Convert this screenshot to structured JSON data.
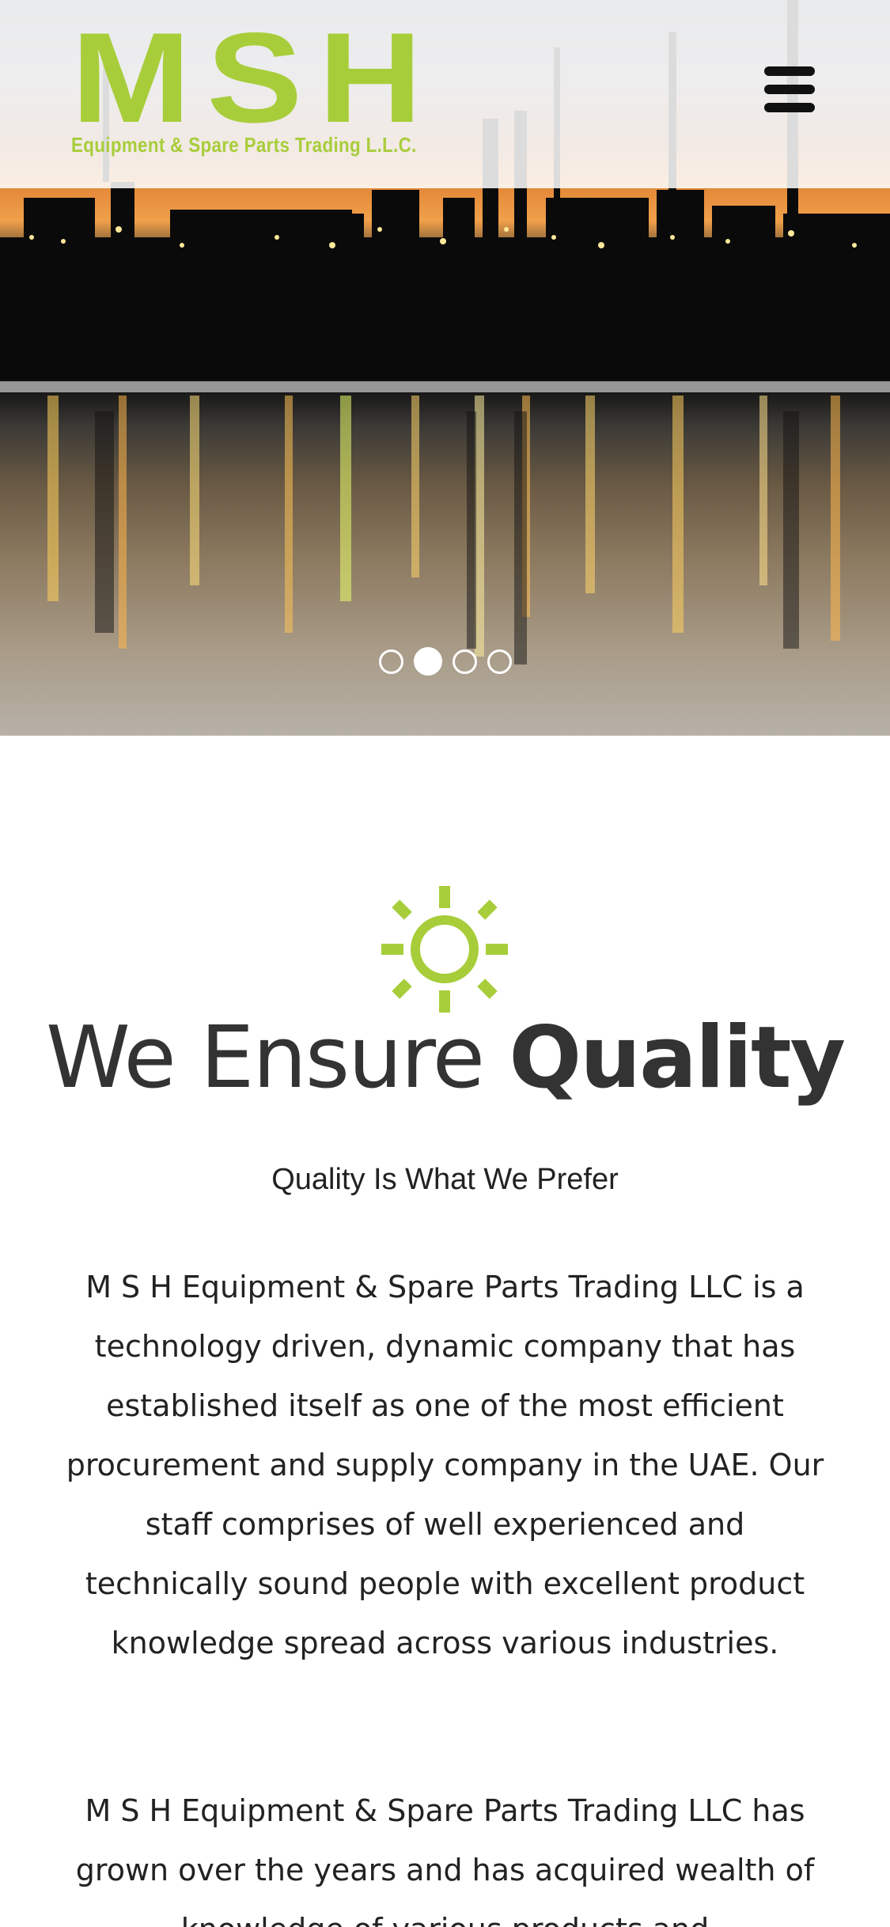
{
  "header": {
    "logo_main": "MSH",
    "logo_sub": "Equipment & Spare Parts Trading L.L.C.",
    "menu_icon": "hamburger-menu-icon",
    "logo_color": "#a8cd3a"
  },
  "slider": {
    "slide_count": 4,
    "active_index": 1
  },
  "intro": {
    "icon": "sun-icon",
    "icon_color": "#a8cd3a",
    "heading_light": "We Ensure ",
    "heading_bold": "Quality",
    "subheading": "Quality Is What We Prefer",
    "paragraph_1": "M S H Equipment & Spare Parts Trading LLC is a technology driven, dynamic company that has established itself as one of the most efficient procurement and supply company in the UAE. Our staff comprises of well experienced and technically sound people with excellent product knowledge spread across various industries.",
    "paragraph_2": "M S H Equipment & Spare Parts Trading LLC has grown over the years and has acquired wealth of knowledge of various products and"
  }
}
